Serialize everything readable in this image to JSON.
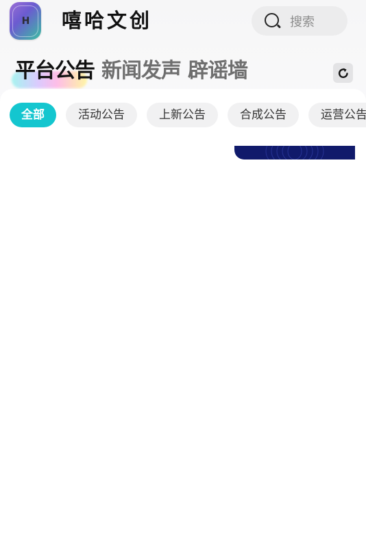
{
  "app": {
    "title": "嘻哈文创",
    "logo_letter": "H"
  },
  "search": {
    "placeholder": "搜索"
  },
  "main_tabs": [
    {
      "label": "平台公告",
      "active": true
    },
    {
      "label": "新闻发声",
      "active": false
    },
    {
      "label": "辟谣墙",
      "active": false
    }
  ],
  "filter_chips": [
    {
      "label": "全部",
      "active": true
    },
    {
      "label": "活动公告",
      "active": false
    },
    {
      "label": "上新公告",
      "active": false
    },
    {
      "label": "合成公告",
      "active": false
    },
    {
      "label": "运营公告",
      "active": false
    }
  ],
  "icons": {
    "search": "search-icon",
    "refresh": "refresh-icon",
    "logo": "app-logo-icon"
  },
  "colors": {
    "accent": "#14c6cf",
    "banner": "#101a6b",
    "active_text": "#111111",
    "inactive_text": "#6e6e6e"
  }
}
